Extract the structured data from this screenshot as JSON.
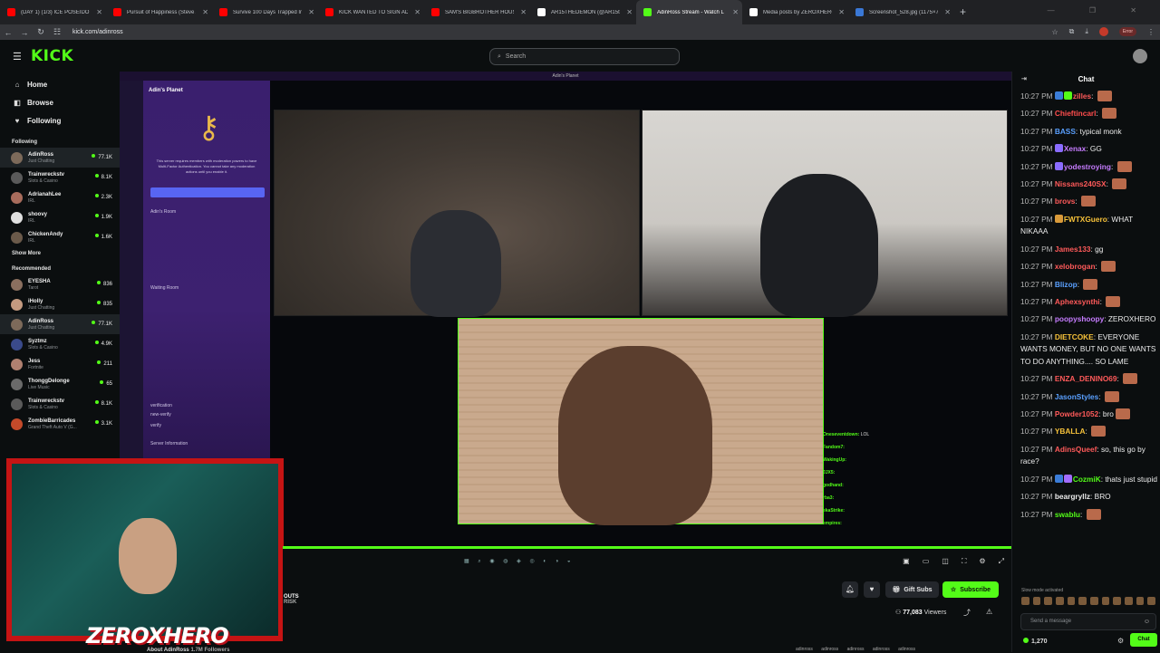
{
  "browser": {
    "tabs": [
      {
        "title": "(DAY 1) (1/3) ICE POSEIDON'S",
        "color": "#ff0000",
        "active": false
      },
      {
        "title": "Pursuit of Happiness (Steve Ao",
        "color": "#ff0000",
        "active": false
      },
      {
        "title": "Survive 100 Days Trapped In A",
        "color": "#ff0000",
        "active": false
      },
      {
        "title": "KICK WANTED TO SIGN ADIN",
        "color": "#ff0000",
        "active": false
      },
      {
        "title": "SAM'S BIGBROTHER HOUSE &",
        "color": "#ff0000",
        "active": false
      },
      {
        "title": "AR15THEDEMON (@AR15the",
        "color": "#ffffff",
        "active": false
      },
      {
        "title": "AdinRoss Stream - Watch L",
        "color": "#53fc18",
        "active": true
      },
      {
        "title": "Media posts by ZEROXHERO (@",
        "color": "#ffffff",
        "active": false
      },
      {
        "title": "Screenshot_528.jpg (1175×707)",
        "color": "#3a78d6",
        "active": false
      }
    ],
    "new_tab": "+",
    "url": "kick.com/adinross",
    "error_label": "Error"
  },
  "kick": {
    "logo": "KICK",
    "search_placeholder": "Search"
  },
  "sidebar": {
    "nav": [
      {
        "label": "Home",
        "icon": "home-icon",
        "glyph": "⌂"
      },
      {
        "label": "Browse",
        "icon": "browse-icon",
        "glyph": "◧"
      },
      {
        "label": "Following",
        "icon": "heart-icon",
        "glyph": "♥"
      }
    ],
    "following_label": "Following",
    "following": [
      {
        "name": "AdinRoss",
        "category": "Just Chatting",
        "viewers": "77.1K",
        "color": "#7d6a5a",
        "selected": true
      },
      {
        "name": "Trainwreckstv",
        "category": "Slots & Casino",
        "viewers": "8.1K",
        "color": "#5a5a5a",
        "selected": false
      },
      {
        "name": "AdrianahLee",
        "category": "IRL",
        "viewers": "2.3K",
        "color": "#a86c5c",
        "selected": false
      },
      {
        "name": "shoovy",
        "category": "IRL",
        "viewers": "1.9K",
        "color": "#e0e0e0",
        "selected": false
      },
      {
        "name": "ChickenAndy",
        "category": "IRL",
        "viewers": "1.6K",
        "color": "#6b5a4a",
        "selected": false
      }
    ],
    "show_more": "Show More",
    "recommended_label": "Recommended",
    "recommended": [
      {
        "name": "EYESHA",
        "category": "Tarot",
        "viewers": "836",
        "color": "#8a6f5f",
        "selected": false
      },
      {
        "name": "iHolly",
        "category": "Just Chatting",
        "viewers": "835",
        "color": "#c49a80",
        "selected": false
      },
      {
        "name": "AdinRoss",
        "category": "Just Chatting",
        "viewers": "77.1K",
        "color": "#7d6a5a",
        "selected": true
      },
      {
        "name": "Syztmz",
        "category": "Slots & Casino",
        "viewers": "4.9K",
        "color": "#3a4a8a",
        "selected": false
      },
      {
        "name": "Jess",
        "category": "Fortnite",
        "viewers": "211",
        "color": "#b08070",
        "selected": false
      },
      {
        "name": "ThonggDelonge",
        "category": "Live Music",
        "viewers": "65",
        "color": "#6a6a6a",
        "selected": false
      },
      {
        "name": "Trainwreckstv",
        "category": "Slots & Casino",
        "viewers": "8.1K",
        "color": "#5a5a5a",
        "selected": false
      },
      {
        "name": "ZombieBarricades",
        "category": "Grand Theft Auto V (G...",
        "viewers": "3.1K",
        "color": "#c44a2a",
        "selected": false
      }
    ]
  },
  "stream": {
    "window_title": "Adin's Planet",
    "server_name": "Adin's Planet",
    "server_message": "This server requires members with moderation powers to have Multi-Factor Authentication. You cannot take any moderation actions until you enable it.",
    "channels": [
      "Adin's Room",
      "Waiting Room",
      "verification",
      "new-verify",
      "verify",
      "Server Information"
    ],
    "overlay_chat": [
      {
        "user": "Oneseventdown:",
        "text": "LOL"
      },
      {
        "user": "Fandom7:",
        "text": ""
      },
      {
        "user": "WakingUp:",
        "text": ""
      },
      {
        "user": "JJX5:",
        "text": ""
      },
      {
        "user": "godhand:",
        "text": ""
      },
      {
        "user": "rba3:",
        "text": ""
      },
      {
        "user": "ekaStrike:",
        "text": ""
      },
      {
        "user": "empires:",
        "text": ""
      }
    ],
    "facecam_logo": "ZEROXHERO",
    "outs_label": "OUTS",
    "risk_label": "RISK"
  },
  "info": {
    "gift_label": "Gift Subs",
    "subscribe_label": "Subscribe",
    "viewers_count": "77,083",
    "viewers_label": "Viewers",
    "about_label": "About AdinRoss",
    "followers": "1.7M Followers",
    "socials": "adinross adinross adinross adinross adinross"
  },
  "chat": {
    "title": "Chat",
    "messages": [
      {
        "time": "10:27 PM",
        "user": "zilles",
        "color": "#ff5a5a",
        "text": "",
        "emote": true,
        "badges": [
          "#3b7dd8",
          "#53fc18"
        ]
      },
      {
        "time": "10:27 PM",
        "user": "Chieftincarl",
        "color": "#ff4d4d",
        "text": "",
        "emote": true,
        "badges": []
      },
      {
        "time": "10:27 PM",
        "user": "BASS",
        "color": "#5aa0ff",
        "text": "typical monk",
        "emote": false,
        "badges": []
      },
      {
        "time": "10:27 PM",
        "user": "Xenax",
        "color": "#c67cff",
        "text": "GG",
        "emote": false,
        "badges": [
          "#8a6cff"
        ]
      },
      {
        "time": "10:27 PM",
        "user": "yodestroying",
        "color": "#c67cff",
        "text": "",
        "emote": true,
        "badges": [
          "#8a6cff"
        ]
      },
      {
        "time": "10:27 PM",
        "user": "Nissans240SX",
        "color": "#ff5a5a",
        "text": "",
        "emote": true,
        "badges": []
      },
      {
        "time": "10:27 PM",
        "user": "brovs",
        "color": "#ff5a5a",
        "text": "",
        "emote": true,
        "badges": []
      },
      {
        "time": "10:27 PM",
        "user": "FWTXGuero",
        "color": "#f7c23a",
        "text": "WHAT NIKAAA",
        "emote": false,
        "badges": [
          "#d99a3a"
        ]
      },
      {
        "time": "10:27 PM",
        "user": "James133",
        "color": "#ff5a5a",
        "text": "gg",
        "emote": false,
        "badges": []
      },
      {
        "time": "10:27 PM",
        "user": "xelobrogan",
        "color": "#ff5a5a",
        "text": "",
        "emote": true,
        "badges": []
      },
      {
        "time": "10:27 PM",
        "user": "Blizop",
        "color": "#5aa0ff",
        "text": "",
        "emote": true,
        "badges": []
      },
      {
        "time": "10:27 PM",
        "user": "Aphexsynthi",
        "color": "#ff5a5a",
        "text": "",
        "emote": true,
        "badges": []
      },
      {
        "time": "10:27 PM",
        "user": "poopyshoopy",
        "color": "#c67cff",
        "text": "ZEROXHERO",
        "emote": false,
        "badges": []
      },
      {
        "time": "10:27 PM",
        "user": "DIETCOKE",
        "color": "#f7c23a",
        "text": "EVERYONE WANTS MONEY, BUT NO ONE WANTS TO DO ANYTHING.... SO LAME",
        "emote": false,
        "badges": []
      },
      {
        "time": "10:27 PM",
        "user": "ENZA_DENINO69",
        "color": "#ff5a5a",
        "text": "",
        "emote": true,
        "badges": []
      },
      {
        "time": "10:27 PM",
        "user": "JasonStyles",
        "color": "#5aa0ff",
        "text": "",
        "emote": true,
        "badges": []
      },
      {
        "time": "10:27 PM",
        "user": "Powder1052",
        "color": "#ff5a5a",
        "text": "bro",
        "emote": true,
        "badges": []
      },
      {
        "time": "10:27 PM",
        "user": "YBALLA",
        "color": "#f7c23a",
        "text": "",
        "emote": true,
        "badges": []
      },
      {
        "time": "10:27 PM",
        "user": "AdinsQueef",
        "color": "#ff5a5a",
        "text": "so, this go by race?",
        "emote": false,
        "badges": []
      },
      {
        "time": "10:27 PM",
        "user": "CozmiK",
        "color": "#53fc18",
        "text": "thats just stupid",
        "emote": false,
        "badges": [
          "#3b7dd8",
          "#a26cff"
        ]
      },
      {
        "time": "10:27 PM",
        "user": "beargryllz",
        "color": "#ececec",
        "text": "BRO",
        "emote": false,
        "badges": []
      },
      {
        "time": "10:27 PM",
        "user": "swablu",
        "color": "#53fc18",
        "text": "",
        "emote": true,
        "badges": []
      }
    ],
    "slow_mode": "Slow mode activated",
    "input_placeholder": "Send a message",
    "points": "1,270",
    "send_label": "Chat"
  }
}
